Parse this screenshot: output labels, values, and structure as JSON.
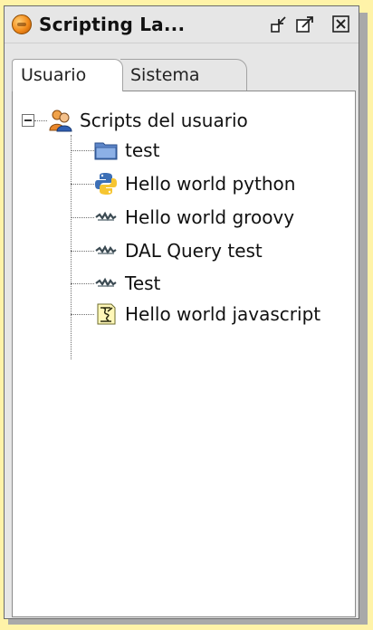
{
  "panel": {
    "title": "Scripting La...",
    "buttons": [
      "minimize-icon",
      "maximize-icon",
      "close-icon"
    ]
  },
  "tabs": [
    {
      "label": "Usuario",
      "active": true
    },
    {
      "label": "Sistema",
      "active": false
    }
  ],
  "tree": {
    "root": {
      "label": "Scripts del usuario",
      "icon": "users-icon",
      "expanded": true
    },
    "children": [
      {
        "label": "test",
        "icon": "folder-icon"
      },
      {
        "label": "Hello world python",
        "icon": "python-icon"
      },
      {
        "label": "Hello world groovy",
        "icon": "groovy-icon"
      },
      {
        "label": "DAL Query test",
        "icon": "groovy-icon"
      },
      {
        "label": "Test",
        "icon": "groovy-icon"
      },
      {
        "label": "Hello world javascript",
        "icon": "javascript-icon"
      }
    ]
  },
  "colors": {
    "background": "#fff3a8",
    "panel": "#e6e6e6",
    "content": "#ffffff"
  }
}
